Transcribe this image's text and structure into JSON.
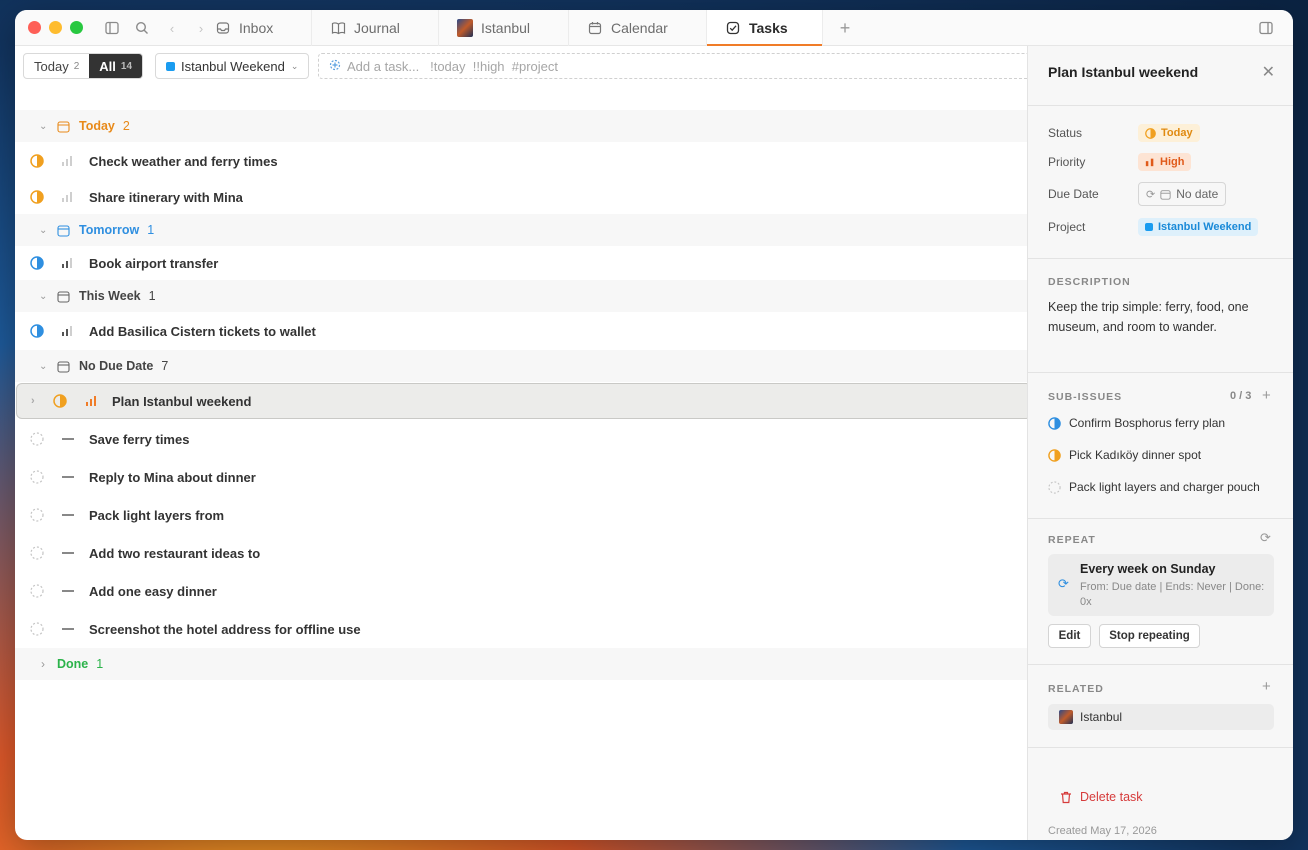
{
  "window": {
    "tabs": [
      {
        "label": "Inbox",
        "icon": "inbox-icon"
      },
      {
        "label": "Journal",
        "icon": "book-icon"
      },
      {
        "label": "Istanbul",
        "icon": "thumbnail-icon"
      },
      {
        "label": "Calendar",
        "icon": "calendar-icon"
      },
      {
        "label": "Tasks",
        "icon": "checkbox-icon",
        "active": true
      }
    ],
    "new_tab": "+"
  },
  "toolbar": {
    "filter_today": "Today",
    "filter_today_count": "2",
    "filter_all": "All",
    "filter_all_count": "14",
    "project_select": "Istanbul Weekend",
    "add_task_placeholder": "Add a task...   !today  !!high  #project"
  },
  "groups": {
    "today": {
      "label": "Today",
      "count": "2"
    },
    "tomorrow": {
      "label": "Tomorrow",
      "count": "1"
    },
    "this_week": {
      "label": "This Week",
      "count": "1"
    },
    "no_due": {
      "label": "No Due Date",
      "count": "7"
    },
    "done": {
      "label": "Done",
      "count": "1"
    }
  },
  "tasks": {
    "t1": "Check weather and ferry times",
    "t2": "Share itinerary with Mina",
    "t3": "Book airport transfer",
    "t4": "Add Basilica Cistern tickets to wallet",
    "t5": "Plan Istanbul weekend",
    "t6": "Save ferry times",
    "t7": "Reply to Mina about dinner",
    "t8": "Pack light layers from",
    "t9": "Add two restaurant ideas to",
    "t10": "Add one easy dinner",
    "t11": "Screenshot the hotel address for offline use"
  },
  "detail": {
    "title": "Plan Istanbul weekend",
    "status_label": "Status",
    "status_value": "Today",
    "priority_label": "Priority",
    "priority_value": "High",
    "due_label": "Due Date",
    "due_value": "No date",
    "project_label": "Project",
    "project_value": "Istanbul Weekend",
    "description_heading": "DESCRIPTION",
    "description": "Keep the trip simple: ferry, food, one museum, and room to wander.",
    "subissues_heading": "SUB-ISSUES",
    "subissues_count": "0 / 3",
    "subissues": [
      "Confirm Bosphorus ferry plan",
      "Pick Kadıköy dinner spot",
      "Pack light layers and charger pouch"
    ],
    "repeat_heading": "REPEAT",
    "repeat_title": "Every week on Sunday",
    "repeat_detail": "From: Due date | Ends: Never | Done: 0x",
    "edit_button": "Edit",
    "stop_button": "Stop repeating",
    "related_heading": "RELATED",
    "related_item": "Istanbul",
    "delete_label": "Delete task",
    "created": "Created May 17, 2026"
  },
  "colors": {
    "accent": "#f07c28",
    "today": "#e88a1a",
    "tomorrow": "#2f8fe0",
    "done": "#2bb34a",
    "project": "#1a9cf0",
    "delete": "#d63b3b"
  }
}
